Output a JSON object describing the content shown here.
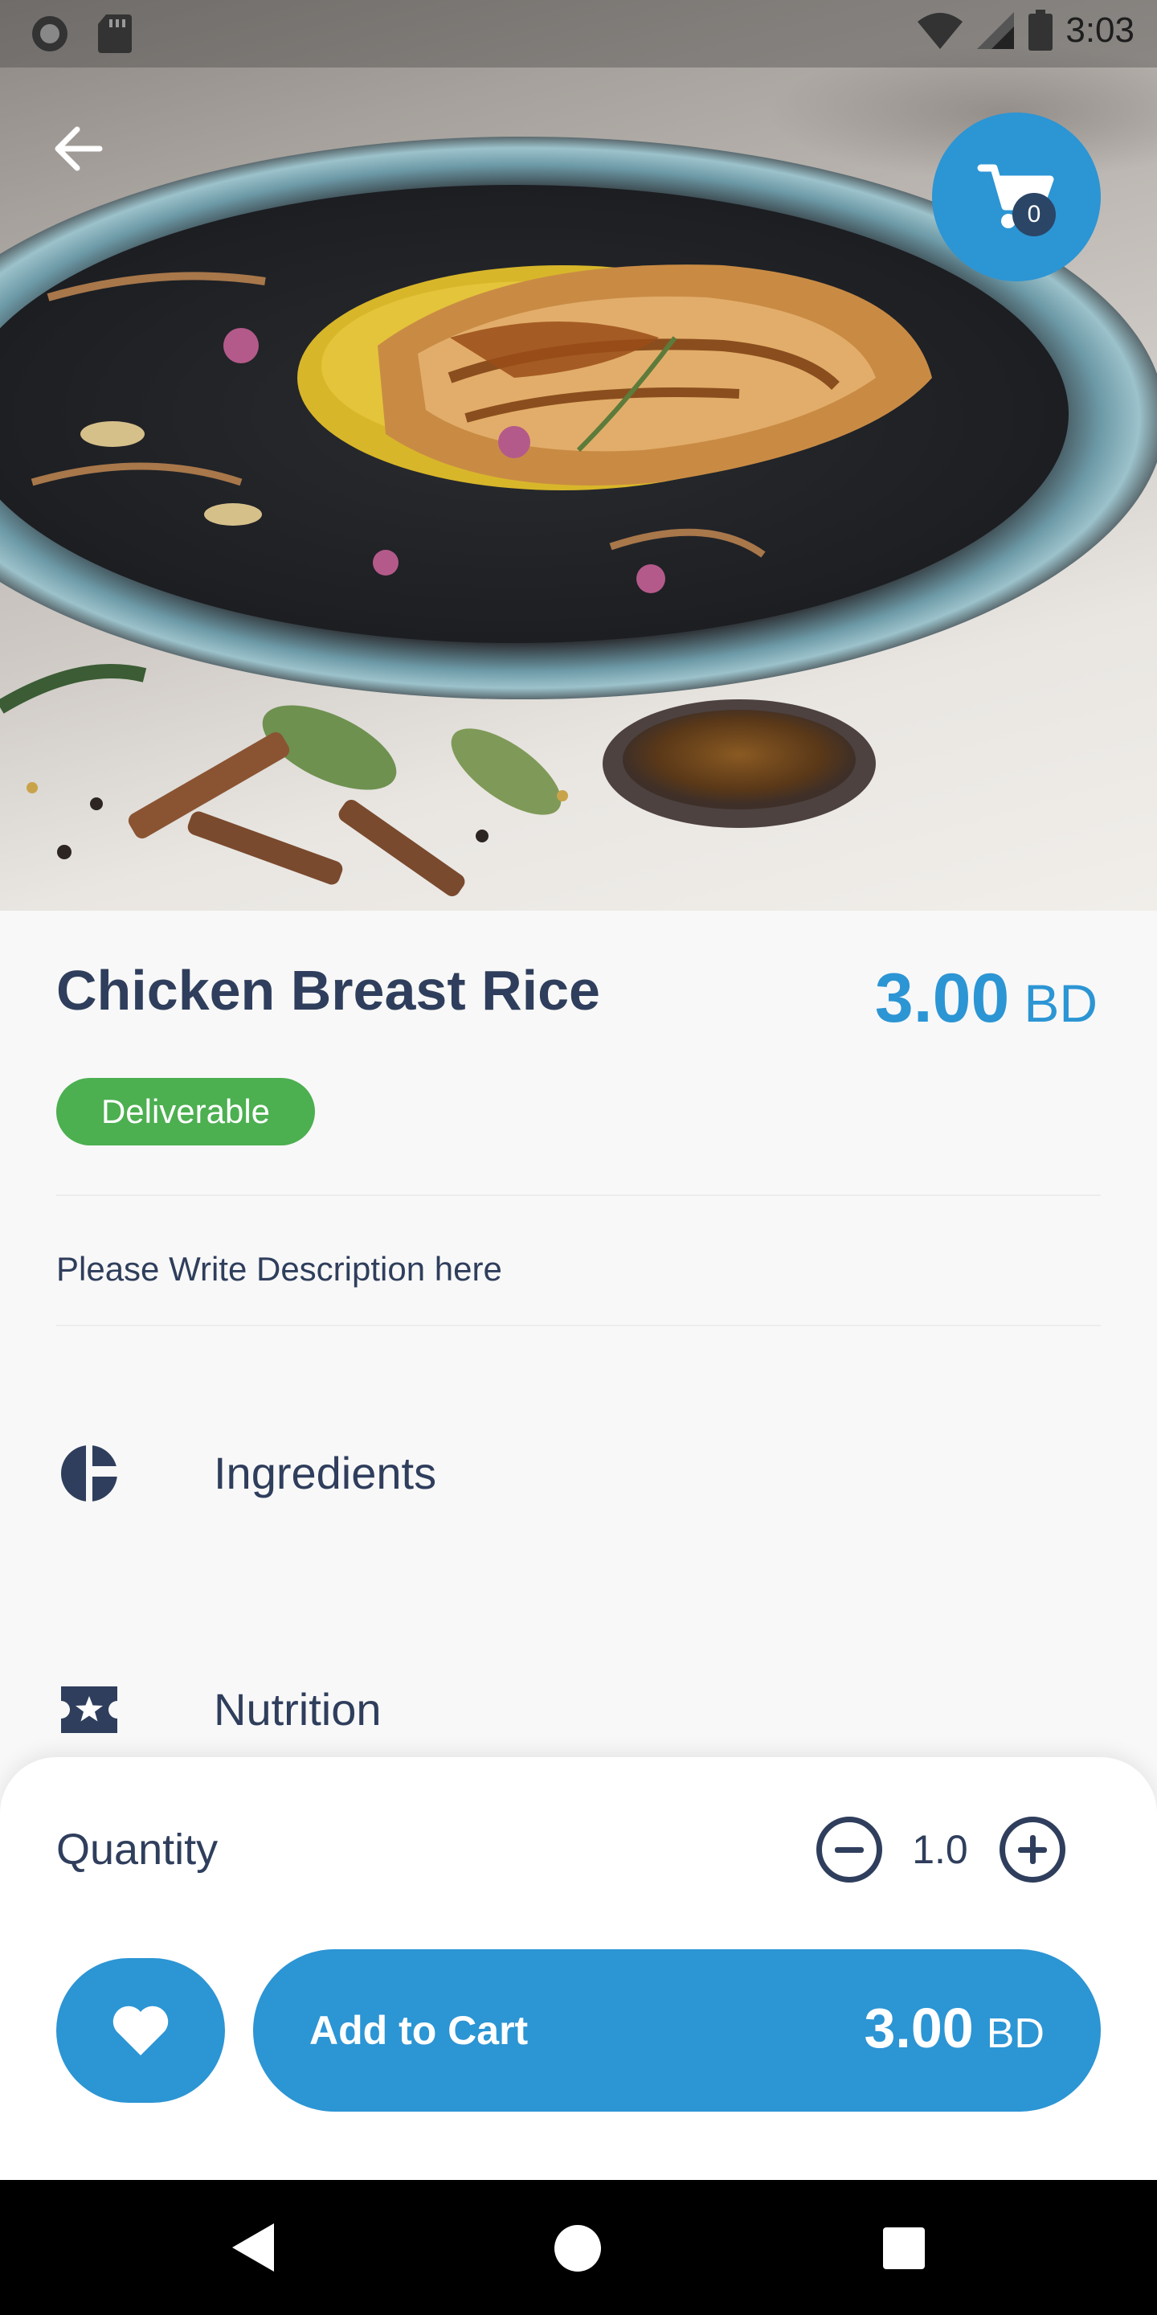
{
  "status_bar": {
    "time": "3:03",
    "icons": [
      "circle-icon",
      "sd-card-icon",
      "wifi-icon",
      "signal-icon",
      "battery-icon"
    ]
  },
  "header": {
    "back_icon": "arrow-left-icon",
    "cart_icon": "cart-icon",
    "cart_count": "0"
  },
  "product": {
    "name": "Chicken Breast Rice",
    "price": "3.00",
    "currency": "BD",
    "badge": "Deliverable",
    "description": "Please Write Description here"
  },
  "sections": [
    {
      "label": "Ingredients",
      "icon": "pie-chart-icon"
    },
    {
      "label": "Nutrition",
      "icon": "ticket-star-icon"
    }
  ],
  "quantity": {
    "label": "Quantity",
    "value": "1.0"
  },
  "actions": {
    "favorite_icon": "heart-icon",
    "add_to_cart_label": "Add to Cart",
    "total": "3.00",
    "currency": "BD"
  },
  "colors": {
    "primary": "#2c95d4",
    "dark_text": "#2f3e5c",
    "success": "#4caf50",
    "badge_bg": "#2b4566"
  }
}
